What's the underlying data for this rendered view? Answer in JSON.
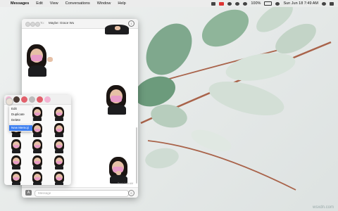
{
  "menubar": {
    "apple": "",
    "items": [
      "Messages",
      "Edit",
      "View",
      "Conversations",
      "Window",
      "Help"
    ],
    "battery": "100%",
    "datetime": "Sun Jun 18 7:49 AM"
  },
  "window": {
    "to_label": "To:",
    "recipient": "Maybe: Grace Wu",
    "info_icon": "i",
    "read_receipt": "Read 7:45 AM"
  },
  "input": {
    "placeholder": "Message",
    "app_icon": "A",
    "emoji_icon": "☺"
  },
  "popover": {
    "tab_count": 9,
    "context_menu": [
      "Edit",
      "Duplicate",
      "Delete",
      "New Memoji"
    ],
    "active_item": "New Memoji"
  },
  "watermark": "wsxdn.com",
  "colors": {
    "mask": "#e89bc8",
    "hair": "#1b1512",
    "skin": "#e6c0a6",
    "highlight": "#3c7ef0",
    "leaf": "#8fb59a"
  }
}
